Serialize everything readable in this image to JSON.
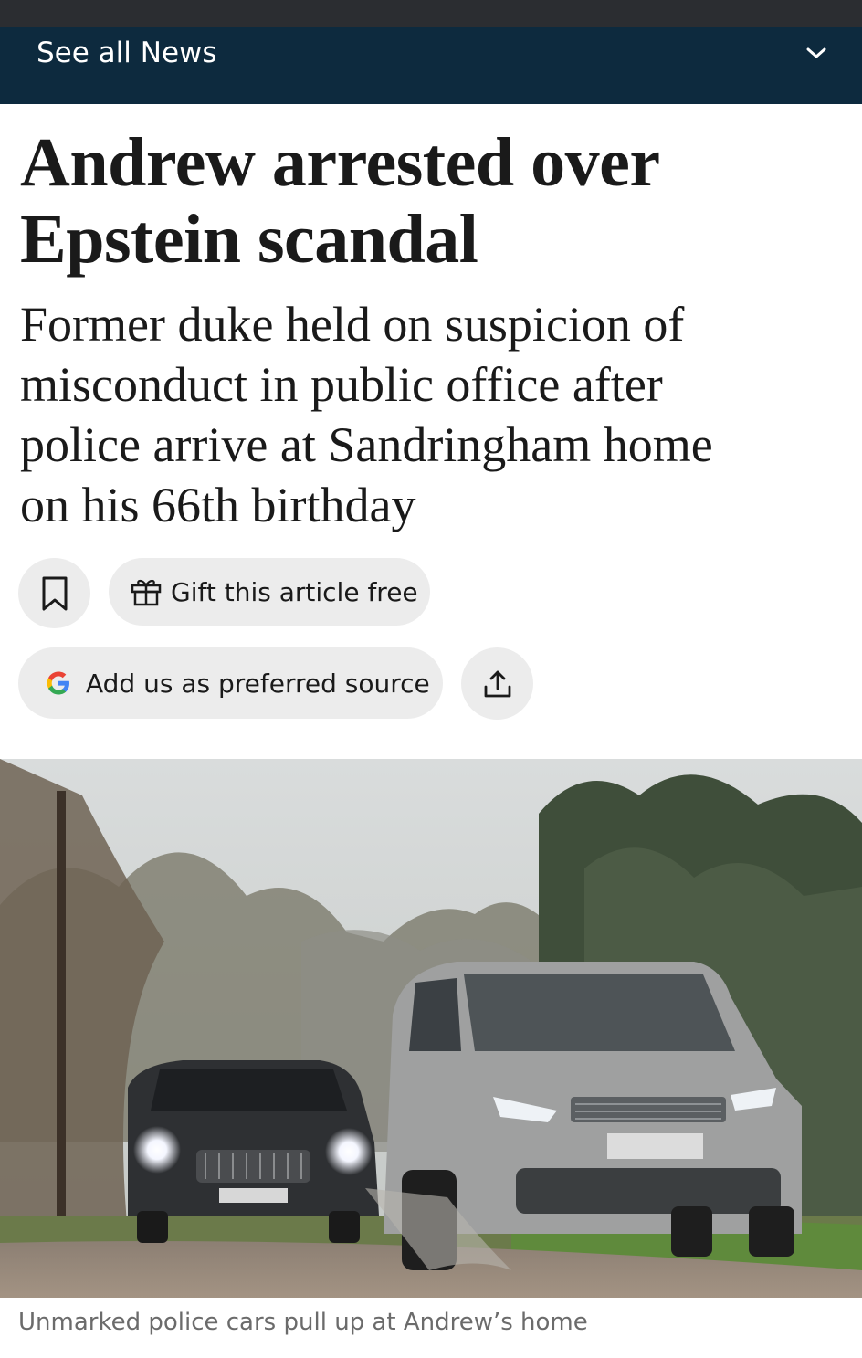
{
  "nav": {
    "label": "See all News",
    "chevron_icon": "chevron-down-icon"
  },
  "article": {
    "headline_line1": "Andrew arrested over",
    "headline_line2": "Epstein scandal",
    "standfirst_lines": [
      "Former duke held on suspicion of",
      "misconduct in public office after",
      "police arrive at Sandringham home",
      "on his 66th birthday"
    ]
  },
  "actions": {
    "bookmark_icon": "bookmark-icon",
    "gift_icon": "gift-icon",
    "gift_label": "Gift this article free",
    "google_icon": "google-g-icon",
    "source_label": "Add us as preferred source",
    "share_icon": "share-icon"
  },
  "image": {
    "caption": "Unmarked police cars pull up at Andrew’s home"
  },
  "colors": {
    "nav_background": "#0d2a3e",
    "pill_background": "#ececec",
    "caption_text": "#6b6b6b"
  }
}
